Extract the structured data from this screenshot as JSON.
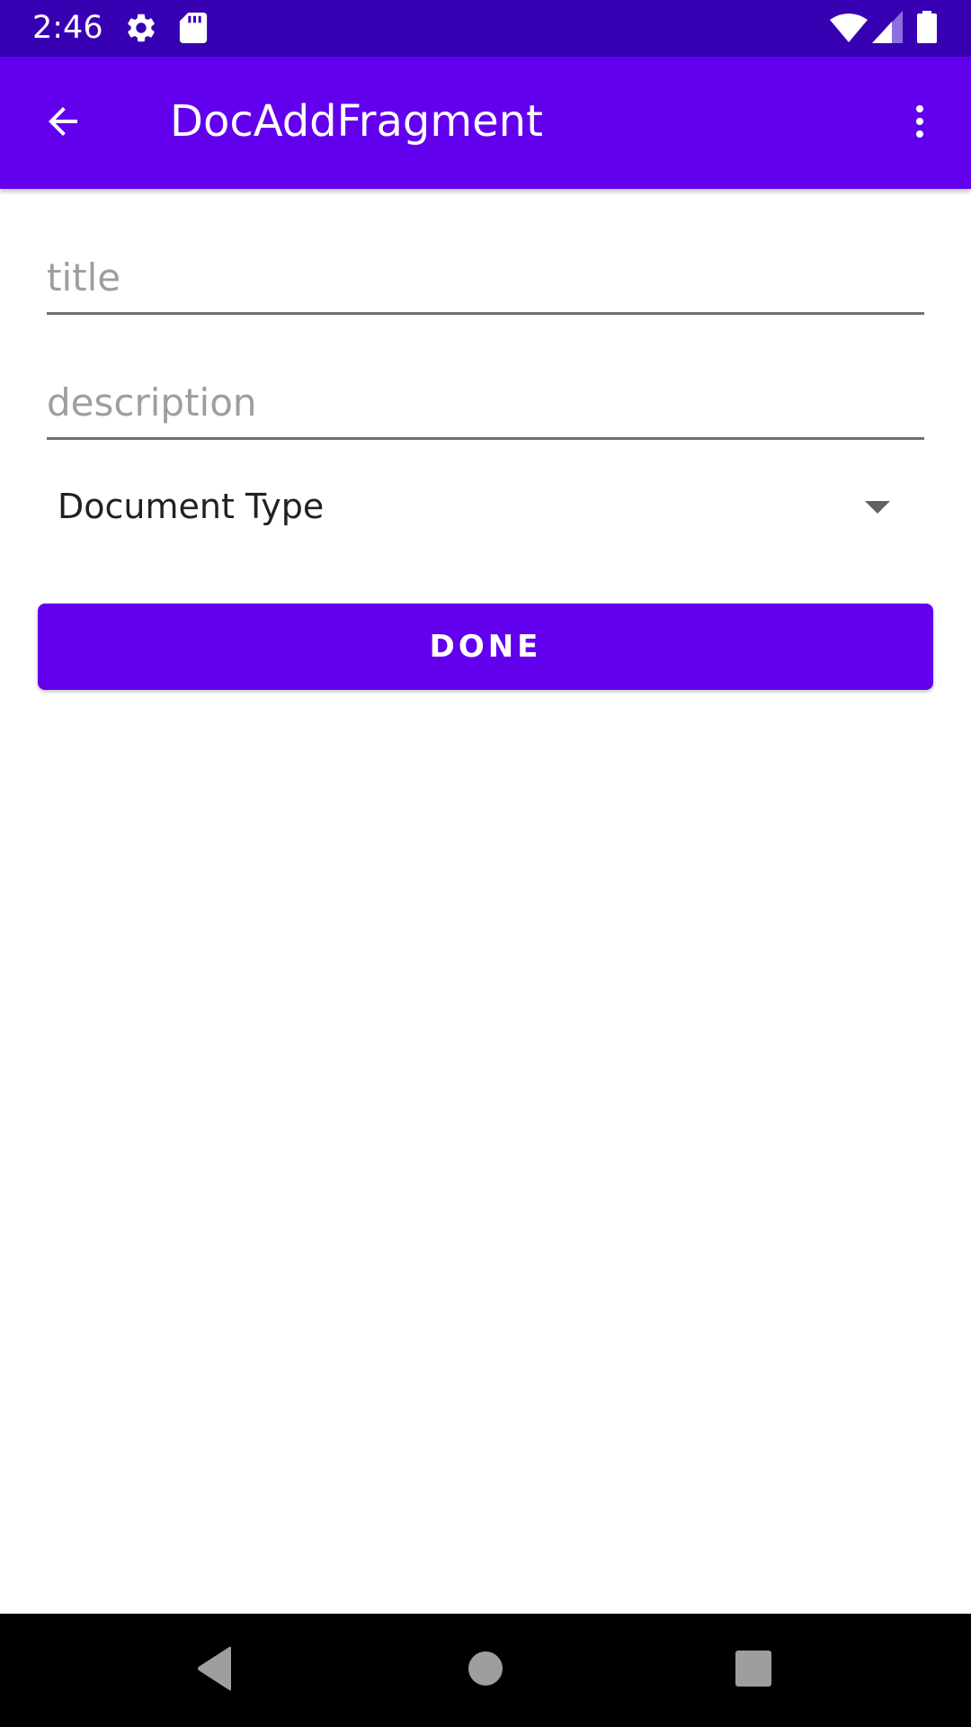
{
  "status_bar": {
    "time": "2:46",
    "icons": [
      "gear-icon",
      "sd-card-icon",
      "wifi-icon",
      "signal-icon",
      "battery-icon"
    ]
  },
  "app_bar": {
    "title": "DocAddFragment",
    "back_icon": "arrow-back-icon",
    "menu_icon": "more-vert-icon"
  },
  "form": {
    "title_field": {
      "placeholder": "title",
      "value": ""
    },
    "description_field": {
      "placeholder": "description",
      "value": ""
    },
    "document_type": {
      "selected": "Document Type"
    },
    "done_label": "DONE"
  },
  "nav_bar": {
    "buttons": [
      "back-triangle-icon",
      "home-circle-icon",
      "recents-square-icon"
    ]
  },
  "colors": {
    "status_bar": "#3700b3",
    "primary": "#6200ee",
    "background": "#ffffff",
    "nav_bar": "#000000"
  }
}
